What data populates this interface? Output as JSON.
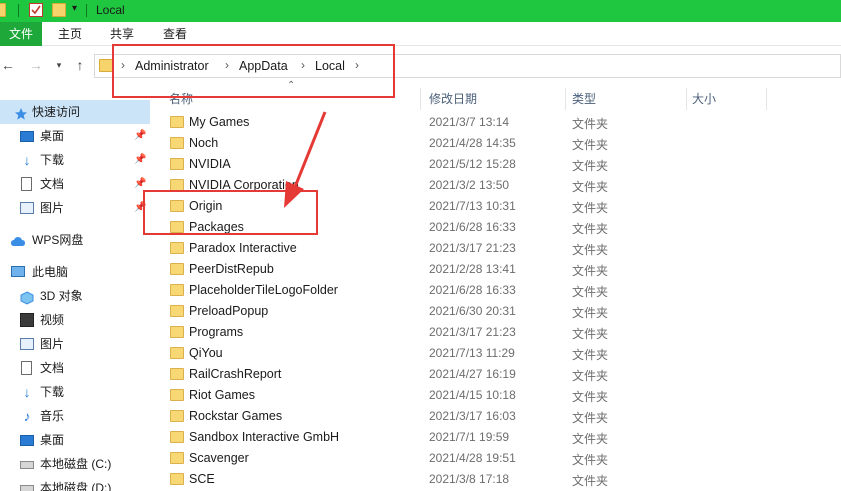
{
  "window": {
    "title": "Local"
  },
  "ribbon": {
    "tabs": [
      "文件",
      "主页",
      "共享",
      "查看"
    ]
  },
  "address": {
    "crumbs": [
      "Administrator",
      "AppData",
      "Local"
    ]
  },
  "sidebar": {
    "items": [
      {
        "label": "快速访问",
        "icon": "star-icon",
        "pinned": false,
        "selected": true
      },
      {
        "label": "桌面",
        "icon": "desktop-icon",
        "pinned": true
      },
      {
        "label": "下载",
        "icon": "download-icon",
        "pinned": true
      },
      {
        "label": "文档",
        "icon": "document-icon",
        "pinned": true
      },
      {
        "label": "图片",
        "icon": "picture-icon",
        "pinned": true
      },
      {
        "label": "WPS网盘",
        "icon": "cloud-icon",
        "pinned": false
      },
      {
        "label": "此电脑",
        "icon": "computer-icon",
        "pinned": false
      },
      {
        "label": "3D 对象",
        "icon": "cube-icon",
        "pinned": false
      },
      {
        "label": "视频",
        "icon": "video-icon",
        "pinned": false
      },
      {
        "label": "图片",
        "icon": "picture-icon",
        "pinned": false
      },
      {
        "label": "文档",
        "icon": "document-icon",
        "pinned": false
      },
      {
        "label": "下载",
        "icon": "download-icon",
        "pinned": false
      },
      {
        "label": "音乐",
        "icon": "music-icon",
        "pinned": false
      },
      {
        "label": "桌面",
        "icon": "desktop-icon",
        "pinned": false
      },
      {
        "label": "本地磁盘 (C:)",
        "icon": "drive-icon",
        "pinned": false
      },
      {
        "label": "本地磁盘 (D:)",
        "icon": "drive-icon",
        "pinned": false
      }
    ]
  },
  "columns": {
    "name": "名称",
    "modified": "修改日期",
    "type": "类型",
    "size": "大小"
  },
  "files": [
    {
      "name": "My Games",
      "date": "2021/3/7 13:14",
      "type": "文件夹"
    },
    {
      "name": "Noch",
      "date": "2021/4/28 14:35",
      "type": "文件夹"
    },
    {
      "name": "NVIDIA",
      "date": "2021/5/12 15:28",
      "type": "文件夹"
    },
    {
      "name": "NVIDIA Corporation",
      "date": "2021/3/2 13:50",
      "type": "文件夹"
    },
    {
      "name": "Origin",
      "date": "2021/7/13 10:31",
      "type": "文件夹"
    },
    {
      "name": "Packages",
      "date": "2021/6/28 16:33",
      "type": "文件夹"
    },
    {
      "name": "Paradox Interactive",
      "date": "2021/3/17 21:23",
      "type": "文件夹"
    },
    {
      "name": "PeerDistRepub",
      "date": "2021/2/28 13:41",
      "type": "文件夹"
    },
    {
      "name": "PlaceholderTileLogoFolder",
      "date": "2021/6/28 16:33",
      "type": "文件夹"
    },
    {
      "name": "PreloadPopup",
      "date": "2021/6/30 20:31",
      "type": "文件夹"
    },
    {
      "name": "Programs",
      "date": "2021/3/17 21:23",
      "type": "文件夹"
    },
    {
      "name": "QiYou",
      "date": "2021/7/13 11:29",
      "type": "文件夹"
    },
    {
      "name": "RailCrashReport",
      "date": "2021/4/27 16:19",
      "type": "文件夹"
    },
    {
      "name": "Riot Games",
      "date": "2021/4/15 10:18",
      "type": "文件夹"
    },
    {
      "name": "Rockstar Games",
      "date": "2021/3/17 16:03",
      "type": "文件夹"
    },
    {
      "name": "Sandbox Interactive GmbH",
      "date": "2021/7/1 19:59",
      "type": "文件夹"
    },
    {
      "name": "Scavenger",
      "date": "2021/4/28 19:51",
      "type": "文件夹"
    },
    {
      "name": "SCE",
      "date": "2021/3/8 17:18",
      "type": "文件夹"
    }
  ],
  "colors": {
    "titlebar": "#1fc63f",
    "accent": "#1fa83a",
    "annotation": "#e53935",
    "folder": "#f8d775"
  }
}
